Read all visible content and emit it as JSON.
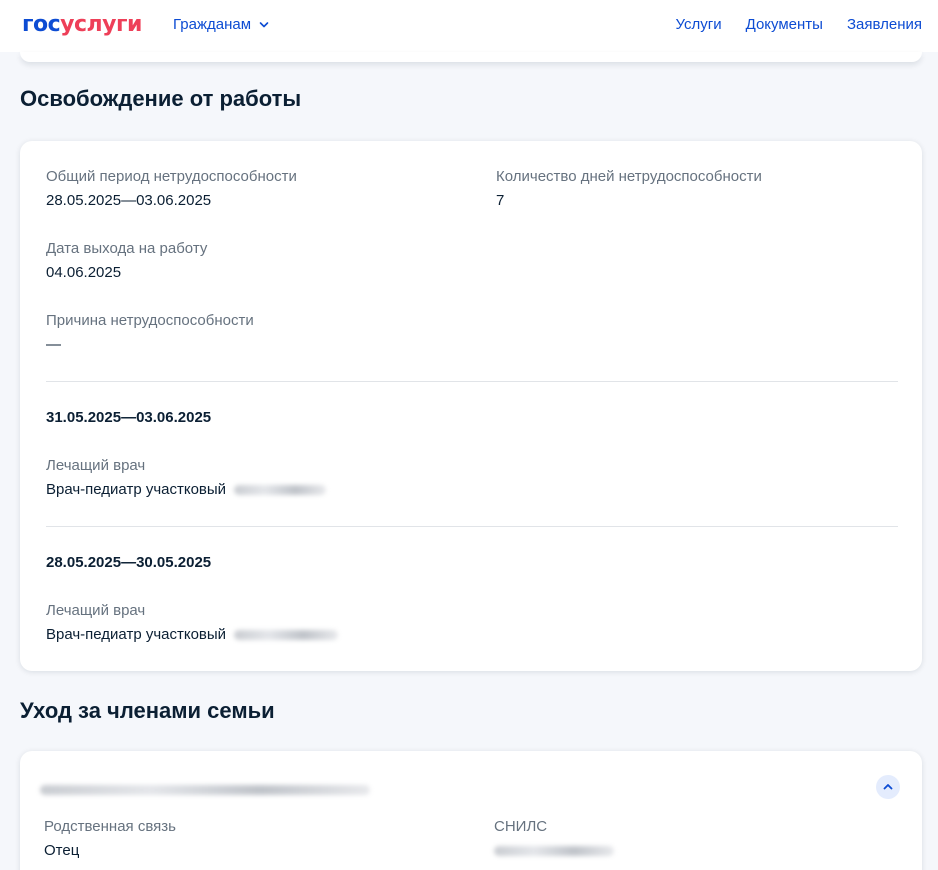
{
  "header": {
    "logo_part1": "гос",
    "logo_part2": "услуги",
    "citizens_menu": "Гражданам",
    "links": [
      "Услуги",
      "Документы",
      "Заявления"
    ]
  },
  "release": {
    "title": "Освобождение от работы",
    "total_period_label": "Общий период нетрудоспособности",
    "total_period_value": "28.05.2025—03.06.2025",
    "days_label": "Количество дней нетрудоспособности",
    "days_value": "7",
    "return_label": "Дата выхода на работу",
    "return_value": "04.06.2025",
    "reason_label": "Причина нетрудоспособности",
    "reason_value": "—",
    "periods": [
      {
        "range": "31.05.2025—03.06.2025",
        "doctor_label": "Лечащий врач",
        "doctor_value": "Врач-педиатр участковый"
      },
      {
        "range": "28.05.2025—30.05.2025",
        "doctor_label": "Лечащий врач",
        "doctor_value": "Врач-педиатр участковый"
      }
    ]
  },
  "family": {
    "title": "Уход за членами семьи",
    "relation_label": "Родственная связь",
    "relation_value": "Отец",
    "snils_label": "СНИЛС"
  },
  "colors": {
    "brand_blue": "#0d4cd3",
    "brand_red": "#ee3f58",
    "text": "#0b1f33",
    "muted": "#66727f"
  }
}
